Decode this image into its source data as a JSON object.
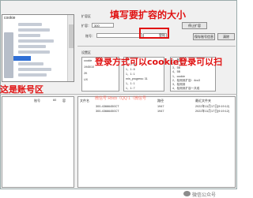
{
  "tree": {
    "header": "cookie",
    "left_labels": [
      "L",
      "LI",
      "U",
      "C",
      "C"
    ]
  },
  "expand": {
    "group_title": "扩容区",
    "capacity_label": "扩容：",
    "capacity_value": "300",
    "account_label": "账号：",
    "account_value": "",
    "login_button": "登陆",
    "stop_button": "停止扩容",
    "save_button": "保存账号信息",
    "clear_button": "清除"
  },
  "settings": {
    "group_title": "设置区",
    "left_lines": [
      "cookie",
      "1945/10",
      "2K",
      "UX"
    ],
    "middle_lines": [
      "50",
      "1，1: 80",
      "1，1: 8",
      "1，1: 1",
      "min_progress: 31",
      "1，1: 1",
      "1，1: 7"
    ],
    "right_lines": [
      "1，账号",
      "2，1, 5B",
      "3，5B",
      "4，5B",
      "1，cookie",
      "2，检测到扩容：4cu3",
      "3，检测到",
      "4，检测到扩容一共成"
    ]
  },
  "annotations": {
    "fill_capacity": "填写要扩容的大小",
    "login_method": "登录方式可以cookie登录可以扫",
    "account_area": "这是账号区"
  },
  "account_table": {
    "headers": [
      "账号",
      "",
      "容"
    ],
    "value": "60"
  },
  "file_table": {
    "headers": [
      "文件名",
      "",
      "",
      "路径",
      "最近文件夹"
    ],
    "rows": [
      {
        "name": "300-43666450CT",
        "path": "1947",
        "date": "2022年11月17日(9:19:12)"
      },
      {
        "name": "300-43666450CT",
        "path": "1947",
        "date": "2022年11月17日(9:19:12)"
      }
    ]
  },
  "watermark": "微信号 Rbcb（QQ 1（微信号",
  "wechat": "微信公众号",
  "colors": {
    "annotation_red": "#e01010",
    "selection_blue": "#2f6fd6"
  }
}
